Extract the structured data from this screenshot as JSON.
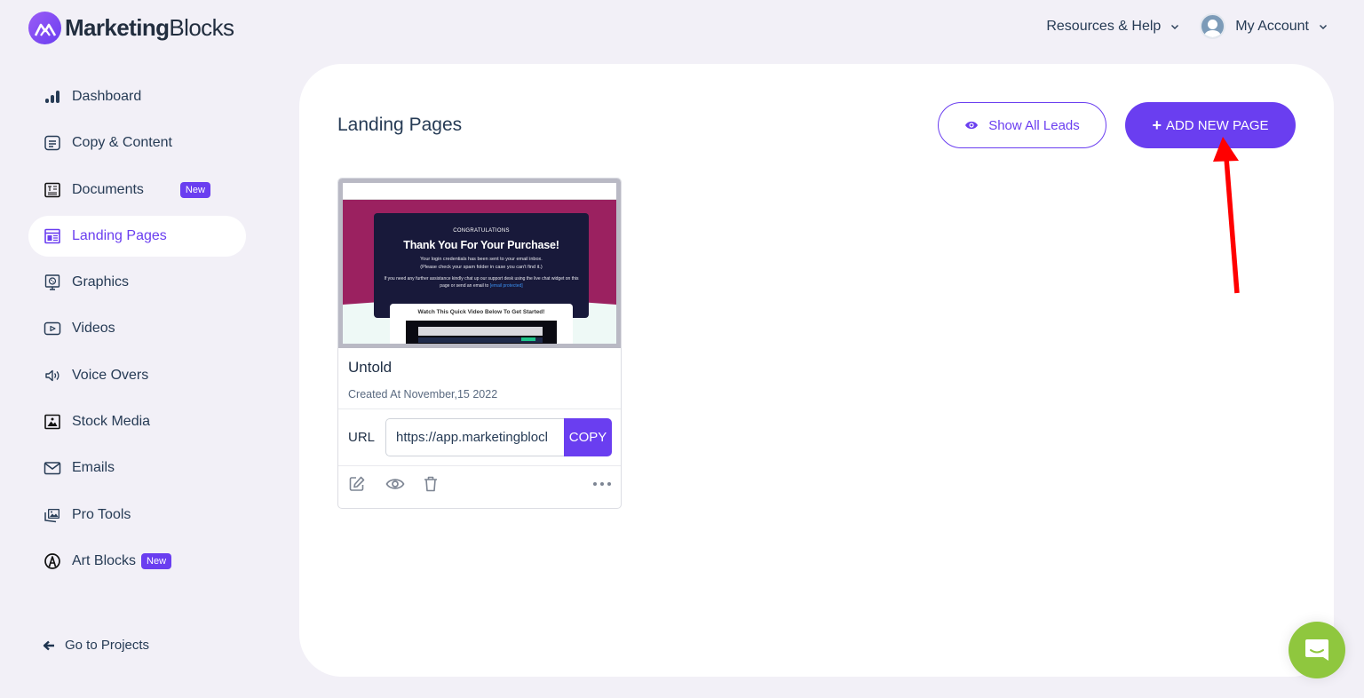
{
  "brand": {
    "name_bold": "Marketing",
    "name_regular": "Blocks",
    "accent_color": "#6a3ef0",
    "logo_icon": "mountain-m-logo-icon"
  },
  "top_nav": {
    "resources_label": "Resources & Help",
    "account_label": "My Account",
    "chevron_icon": "chevron-down-icon",
    "avatar_icon": "user-avatar-icon"
  },
  "sidebar": {
    "items": [
      {
        "label": "Dashboard",
        "icon": "bar-chart-icon"
      },
      {
        "label": "Copy & Content",
        "icon": "document-lines-icon"
      },
      {
        "label": "Documents",
        "icon": "text-document-icon",
        "badge": "New"
      },
      {
        "label": "Landing Pages",
        "icon": "landing-page-icon",
        "active": true
      },
      {
        "label": "Graphics",
        "icon": "graphics-monitor-icon"
      },
      {
        "label": "Videos",
        "icon": "video-play-icon"
      },
      {
        "label": "Voice Overs",
        "icon": "speaker-icon"
      },
      {
        "label": "Stock Media",
        "icon": "image-icon"
      },
      {
        "label": "Emails",
        "icon": "envelope-icon"
      },
      {
        "label": "Pro Tools",
        "icon": "photos-stack-icon"
      },
      {
        "label": "Art Blocks",
        "icon": "art-pen-icon",
        "badge": "New"
      }
    ],
    "go_to_projects": "Go to Projects"
  },
  "main": {
    "title": "Landing Pages",
    "show_leads_label": "Show All Leads",
    "add_new_label": "ADD NEW PAGE",
    "add_new_symbol": "+"
  },
  "pages": [
    {
      "title": "Untold",
      "created": "Created At November,15 2022",
      "url_label": "URL",
      "url_value": "https://app.marketingblocks.ai/...",
      "url_display": "https://app.marketingblocl",
      "copy_label": "COPY",
      "preview": {
        "eyebrow": "CONGRATULATIONS",
        "headline": "Thank You For Your Purchase!",
        "line1": "Your login credentials has been sent to your email inbox.",
        "line2": "(Please check your spam folder in case you can't find it.)",
        "line3": "If you need any further assistance kindly chat up our support desk using the live chat widget on this page or send an email to",
        "email_link": "[email protected]",
        "video_title": "Watch This Quick Video Below To Get Started!"
      },
      "actions": [
        "edit-icon",
        "preview-eye-icon",
        "trash-icon",
        "more-options-icon"
      ]
    }
  ],
  "chat_widget": {
    "icon": "chat-bubble-icon",
    "color": "#8fc73e"
  }
}
